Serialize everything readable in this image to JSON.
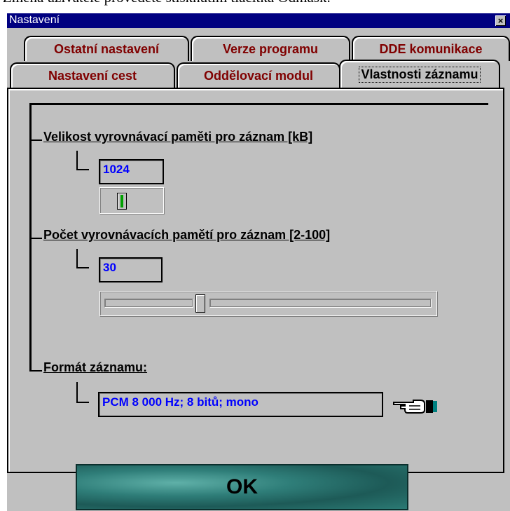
{
  "doc_text": "Změna uživatele provedete stisknutím tlačítka Odmask.",
  "window": {
    "title": "Nastavení",
    "close_glyph": "×"
  },
  "tabs": {
    "row_back": [
      "Ostatní nastavení",
      "Verze programu",
      "DDE komunikace"
    ],
    "row_front": [
      "Nastavení cest",
      "Oddělovací modul",
      "Vlastnosti záznamu"
    ],
    "active": "Vlastnosti záznamu"
  },
  "section_buffer_size": {
    "label": "Velikost vyrovnávací paměti pro záznam [kB]",
    "value": "1024"
  },
  "section_buffer_count": {
    "label": "Počet vyrovnávacích pamětí pro záznam [2-100]",
    "value": "30"
  },
  "section_format": {
    "label": "Formát záznamu:",
    "value": "PCM 8 000 Hz; 8 bitů; mono",
    "pointer_icon": "pointing-hand-icon"
  },
  "ok_button": {
    "label": "OK"
  },
  "colors": {
    "title_bar": "#000080",
    "tab_text": "#800000",
    "value_text": "#0000ff",
    "ok_background": "#2f7e79"
  }
}
